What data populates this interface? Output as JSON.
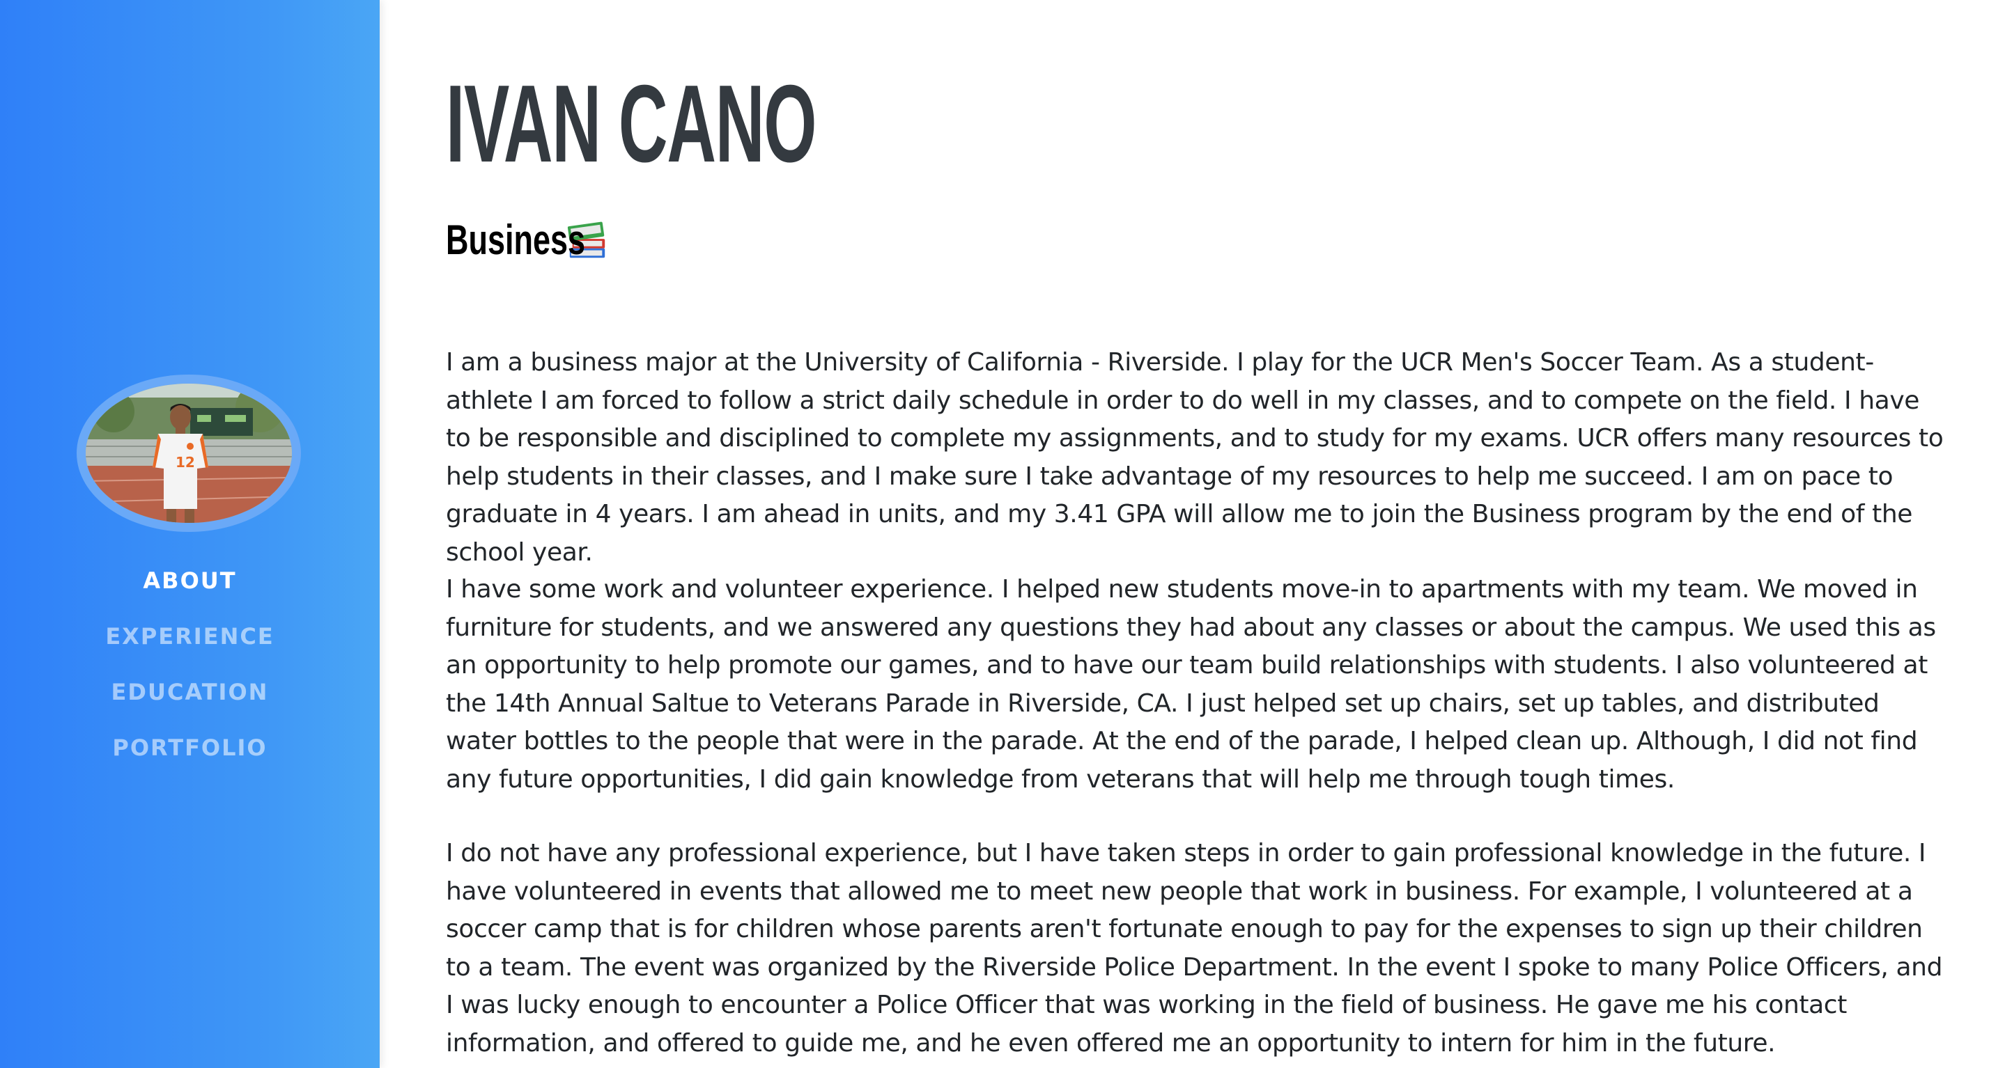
{
  "sidebar": {
    "nav": [
      {
        "label": "ABOUT",
        "active": true
      },
      {
        "label": "EXPERIENCE",
        "active": false
      },
      {
        "label": "EDUCATION",
        "active": false
      },
      {
        "label": "PORTFOLIO",
        "active": false
      }
    ],
    "background_gradient": [
      "#2f80f8",
      "#4aa6f5"
    ],
    "avatar_icon": "profile-photo",
    "jersey_number": "12"
  },
  "header": {
    "name": "IVAN CANO",
    "subtitle": "Business",
    "subtitle_icon": "books-icon"
  },
  "about": {
    "paragraphs": [
      "I am a business major at the University of California - Riverside. I play for the UCR Men's Soccer Team. As a student-athlete I am forced to follow a strict daily schedule in order to do well in my classes, and to compete on the field. I have to be responsible and disciplined to complete my assignments, and to study for my exams. UCR offers many resources to help students in their classes, and I make sure I take advantage of my resources to help me succeed. I am on pace to graduate in 4 years. I am ahead in units, and my 3.41 GPA will allow me to join the Business program by the end of the school year.",
      "I have some work and volunteer experience. I helped new students move-in to apartments with my team. We moved in furniture for students, and we answered any questions they had about any classes or about the campus. We used this as an opportunity to help promote our games, and to have our team build relationships with students. I also volunteered at the 14th Annual Saltue to Veterans Parade in Riverside, CA. I just helped set up chairs, set up tables, and distributed water bottles to the people that were in the parade. At the end of the parade, I helped clean up. Although, I did not find any future opportunities, I did gain knowledge from veterans that will help me through tough times.",
      "I do not have any professional experience, but I have taken steps in order to gain professional knowledge in the future. I have volunteered in events that allowed me to meet new people that work in business. For example, I volunteered at a soccer camp that is for children whose parents aren't fortunate enough to pay for the expenses to sign up their children to a team. The event was organized by the Riverside Police Department. In the event I spoke to many Police Officers, and I was lucky enough to encounter a Police Officer that was working in the field of business. He gave me his contact information, and offered to guide me, and he even offered me an opportunity to intern for him in the future."
    ]
  }
}
